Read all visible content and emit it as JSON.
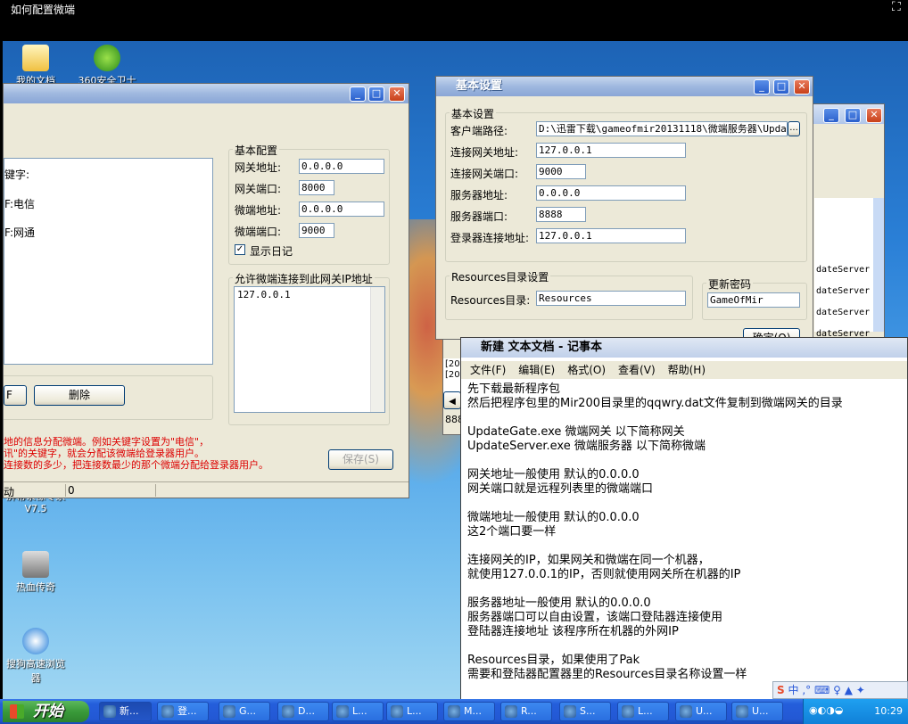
{
  "window_title": "如何配置微端",
  "desktop_icons": [
    {
      "label": "我的文档",
      "name": "documents-icon"
    },
    {
      "label": "360安全卫士",
      "name": "360-security-icon"
    },
    {
      "label": "屏幕录像专家V7.5",
      "name": "screen-recorder-icon"
    },
    {
      "label": "热血传奇",
      "name": "legend-game-icon"
    },
    {
      "label": "搜狗高速浏览器",
      "name": "sogou-browser-icon"
    }
  ],
  "gate": {
    "list_items": [
      "键字:",
      "F:电信",
      "F:网通"
    ],
    "basic_group": "基本配置",
    "gate_addr_label": "网关地址:",
    "gate_addr": "0.0.0.0",
    "gate_port_label": "网关端口:",
    "gate_port": "8000",
    "micro_addr_label": "微端地址:",
    "micro_addr": "0.0.0.0",
    "micro_port_label": "微端端口:",
    "micro_port": "9000",
    "show_log_label": "显示日记",
    "allow_group": "允许微端连接到此网关IP地址",
    "allow_ip": "127.0.0.1",
    "add_label": "F",
    "delete_label": "删除",
    "hint1": "地的信息分配微端。例如关键字设置为\"电信\"，",
    "hint2": "讯\"的关键字，就会分配该微端给登录器用户。",
    "hint3": "连接数的多少，把连接数最少的那个微端分配给登录器用户。",
    "save_label": "保存(S)",
    "status_left": "动",
    "status_count": "0"
  },
  "settings": {
    "title": "基本设置",
    "group": "基本设置",
    "client_path_label": "客户端路径:",
    "client_path": "D:\\迅雷下载\\gameofmir20131118\\微端服务器\\Updat",
    "browse_label": "...",
    "gate_addr_label": "连接网关地址:",
    "gate_addr": "127.0.0.1",
    "gate_port_label": "连接网关端口:",
    "gate_port": "9000",
    "server_addr_label": "服务器地址:",
    "server_addr": "0.0.0.0",
    "server_port_label": "服务器端口:",
    "server_port": "8888",
    "login_addr_label": "登录器连接地址:",
    "login_addr": "127.0.0.1",
    "res_group": "Resources目录设置",
    "res_label": "Resources目录:",
    "res_value": "Resources",
    "pwd_group": "更新密码",
    "pwd_value": "GameOfMir",
    "ok_label": "确定(O)"
  },
  "backwin": {
    "items": [
      "dateServer",
      "dateServer",
      "dateServer",
      "dateServer"
    ],
    "log1": "[20",
    "log2": "[20",
    "num": "888"
  },
  "notepad": {
    "title": "新建 文本文档 - 记事本",
    "menu": [
      "文件(F)",
      "编辑(E)",
      "格式(O)",
      "查看(V)",
      "帮助(H)"
    ],
    "lines": [
      "先下载最新程序包",
      "然后把程序包里的Mir200目录里的qqwry.dat文件复制到微端网关的目录",
      "",
      "UpdateGate.exe 微端网关 以下简称网关",
      "UpdateServer.exe 微端服务器 以下简称微端",
      "",
      "网关地址一般使用 默认的0.0.0.0",
      "网关端口就是远程列表里的微端端口",
      "",
      "微端地址一般使用 默认的0.0.0.0",
      "这2个端口要一样",
      "",
      "连接网关的IP，如果网关和微端在同一个机器，",
      "就使用127.0.0.1的IP，否则就使用网关所在机器的IP",
      "",
      "服务器地址一般使用 默认的0.0.0.0",
      "服务器端口可以自由设置，该端口登陆器连接使用",
      "登陆器连接地址 该程序所在机器的外网IP",
      "",
      "Resources目录，如果使用了Pak",
      "需要和登陆器配置器里的Resources目录名称设置一样"
    ]
  },
  "ime": {
    "label": "中"
  },
  "taskbar": {
    "start": "开始",
    "items": [
      "新...",
      "登...",
      "G...",
      "D...",
      "L...",
      "L...",
      "M...",
      "R...",
      "S...",
      "L...",
      "U...",
      "U..."
    ],
    "clock": "10:29"
  }
}
